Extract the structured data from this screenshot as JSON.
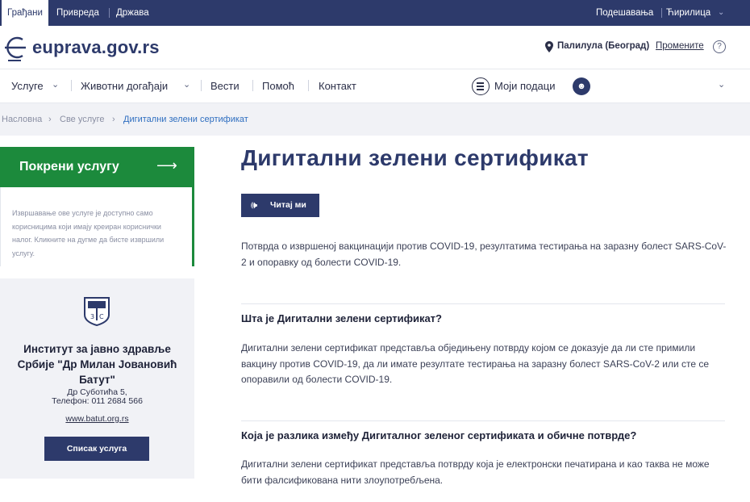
{
  "topbar": {
    "tabs": [
      "Грађани",
      "Привреда",
      "Држава"
    ],
    "settings": "Подешавања",
    "script": "Ћирилица"
  },
  "header": {
    "logo_text": "euprava.gov.rs",
    "location": "Палилула (Београд)",
    "change_location": "Промените",
    "help": "?"
  },
  "nav": {
    "items": [
      "Услуге",
      "Животни догађаји",
      "Вести",
      "Помоћ",
      "Контакт"
    ],
    "my_data": "Моји подаци"
  },
  "breadcrumb": {
    "items": [
      "Насловна",
      "Све услуге",
      "Дигитални зелени сертификат"
    ]
  },
  "sidebar": {
    "start_label": "Покрени услугу",
    "note": "Извршавање ове услуге је доступно само корисницима који имају креиран кориснички налог. Кликните на дугме да бисте извршили услугу.",
    "institution": {
      "name": "Институт за јавно здравље Србије \"Др Милан Јовановић Батут\"",
      "address": "Др Суботића 5,",
      "phone": "Телефон: 011 2684 566",
      "website": "www.batut.org.rs",
      "services_button": "Списак услуга"
    }
  },
  "main": {
    "title": "Дигитални зелени сертификат",
    "read_button": "Читај ми",
    "intro": "Потврда о извршеној вакцинацији против COVID-19, резултатима тестирања на заразну болест SARS-CoV-2 и опоравку од болести COVID-19.",
    "sections": [
      {
        "question": "Шта је Дигитални зелени сертификат?",
        "answer": "Дигитални зелени сертификат представља обједињену потврду којом се доказује да ли сте примили вакцину против COVID-19, да ли имате резултате тестирања на заразну болест SARS-CoV-2 или сте се опоравили од болести COVID-19."
      },
      {
        "question": "Која је разлика између Дигиталног зеленог сертификата и обичне потврде?",
        "answer": "Дигитални зелени сертификат представља потврду која је електронски печатирана и као таква не може бити фалсификована нити злоупотребљена."
      }
    ]
  },
  "colors": {
    "brand_navy": "#2d3a6b",
    "start_green": "#1c8a3c",
    "link_blue": "#2e6ec0"
  }
}
